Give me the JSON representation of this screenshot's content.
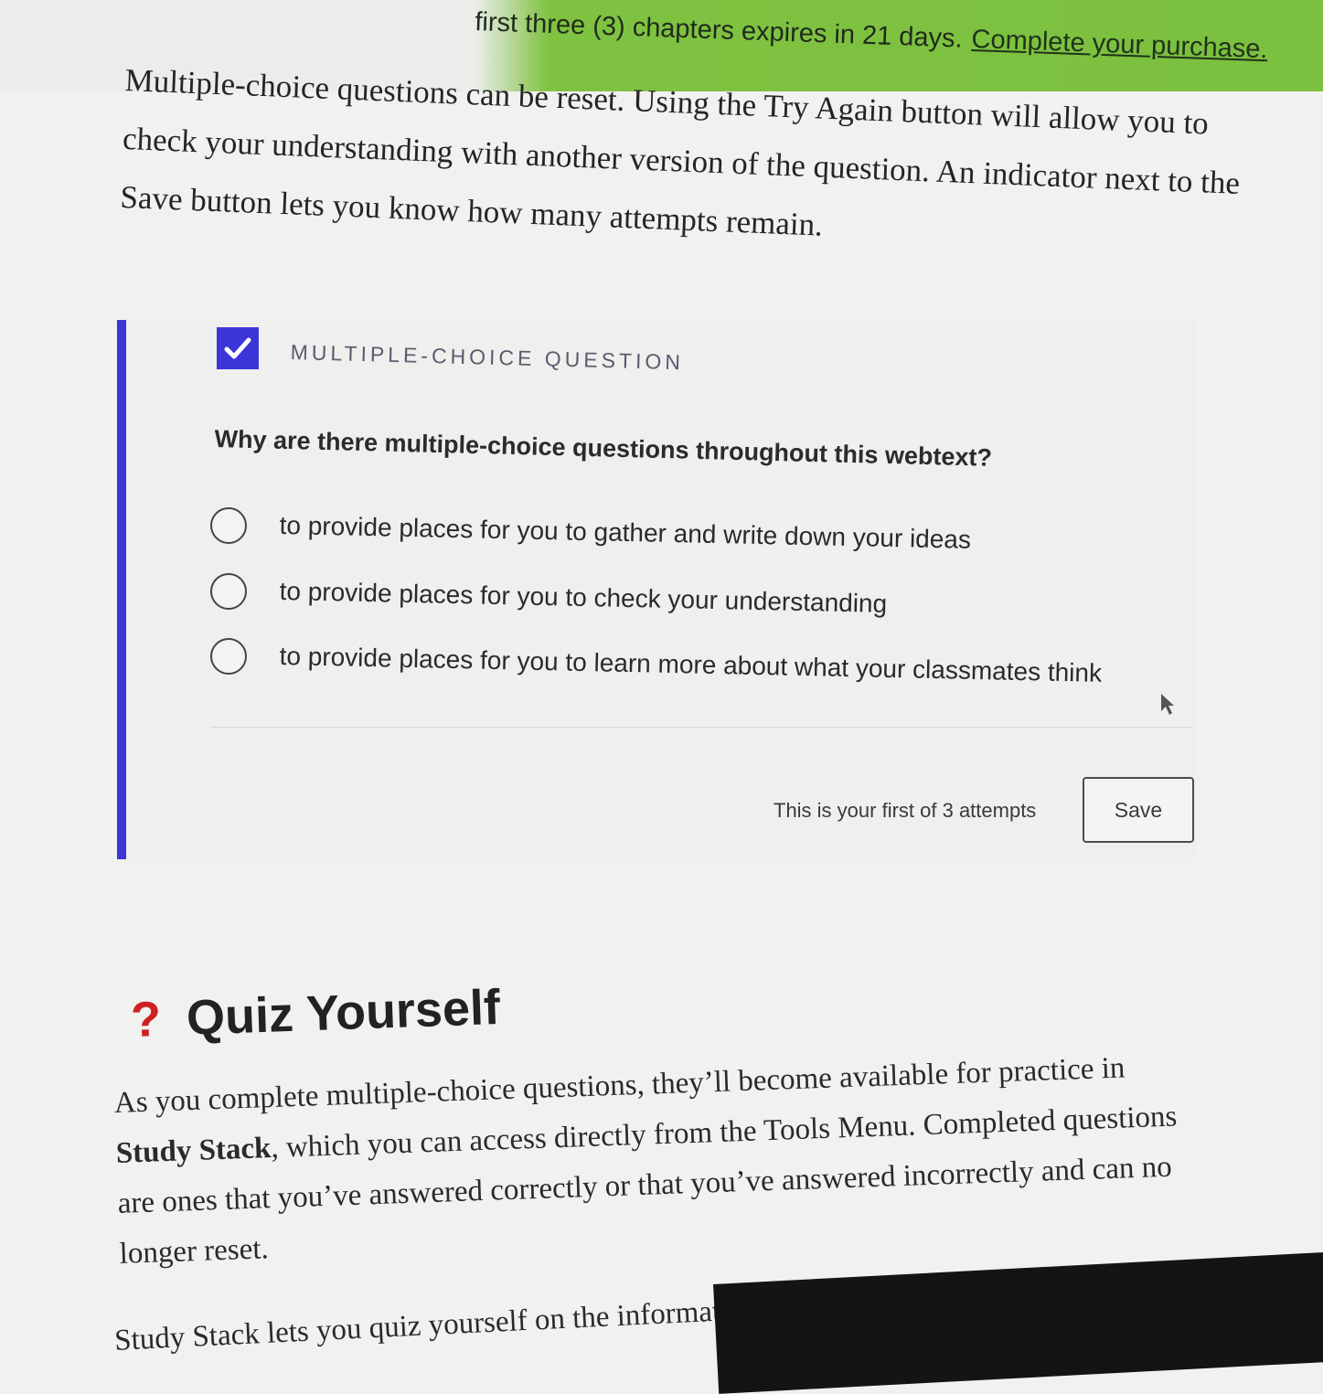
{
  "banner": {
    "text": "first three (3) chapters expires in 21 days.",
    "link": "Complete your purchase."
  },
  "intro": {
    "text": "Multiple-choice questions can be reset. Using the Try Again button will allow you to check your understanding with another version of the question. An indicator next to the Save button lets you know how many attempts remain."
  },
  "question": {
    "label": "MULTIPLE-CHOICE QUESTION",
    "text": "Why are there multiple-choice questions throughout this webtext?",
    "options": [
      {
        "label": "to provide places for you to gather and write down your ideas"
      },
      {
        "label": "to provide places for you to check your understanding"
      },
      {
        "label": "to provide places for you to learn more about what your classmates think"
      }
    ],
    "attempts": "This is your first of 3 attempts",
    "save": "Save"
  },
  "quiz": {
    "icon": "?",
    "title": "Quiz Yourself",
    "para_start": "As you complete multiple-choice questions, they’ll become available for practice in ",
    "para_bold": "Study Stack",
    "para_end": ", which you can access directly from the Tools Menu. Completed questions are ones that you’ve answered correctly or that you’ve answered incorrectly and can no longer reset.",
    "para2": "Study Stack lets you quiz yourself on the information presented in each chapter. You’ll"
  },
  "colors": {
    "accent": "#3d35d8",
    "banner": "#7cc03f",
    "quiz_icon": "#cc2222"
  }
}
